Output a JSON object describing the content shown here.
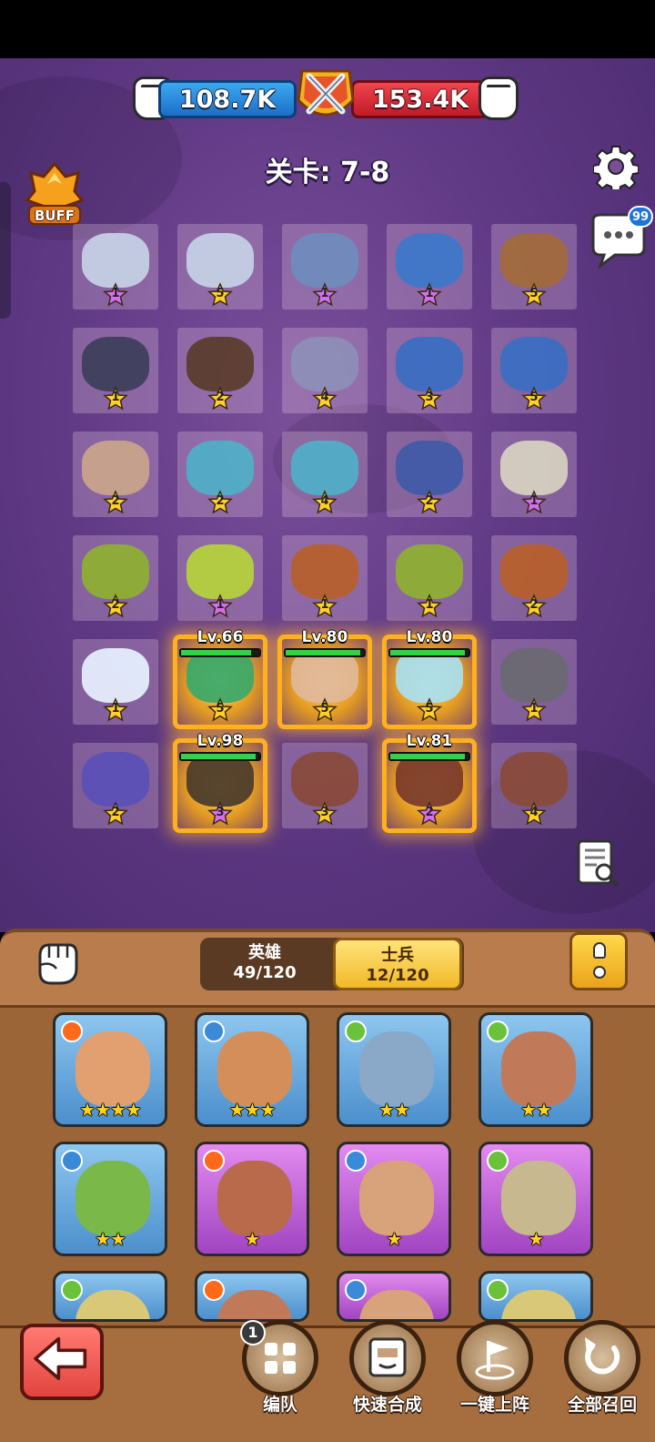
{
  "power": {
    "ally": "108.7K",
    "enemy": "153.4K"
  },
  "level_label": "关卡: 7-8",
  "buff_label": "BUFF",
  "chat_badge": "99",
  "board": [
    [
      {
        "stars": "1",
        "kind": "purple",
        "color": "#c7d3e6"
      },
      {
        "stars": "5",
        "kind": "gold",
        "color": "#c7d3e6"
      },
      {
        "stars": "1",
        "kind": "purple",
        "color": "#6f8dbd"
      },
      {
        "stars": "1",
        "kind": "purple",
        "color": "#3b78c9"
      },
      {
        "stars": "5",
        "kind": "gold",
        "color": "#a36a3a"
      }
    ],
    [
      {
        "stars": "1",
        "kind": "gold",
        "color": "#3c3f5a"
      },
      {
        "stars": "2",
        "kind": "gold",
        "color": "#5a3c2c"
      },
      {
        "stars": "4",
        "kind": "gold",
        "color": "#8d8fb8"
      },
      {
        "stars": "3",
        "kind": "gold",
        "color": "#3b6ec2"
      },
      {
        "stars": "5",
        "kind": "gold",
        "color": "#3b6ec2"
      }
    ],
    [
      {
        "stars": "2",
        "kind": "gold",
        "color": "#caa58a"
      },
      {
        "stars": "2",
        "kind": "gold",
        "color": "#4fb0c8"
      },
      {
        "stars": "4",
        "kind": "gold",
        "color": "#4fb0c8"
      },
      {
        "stars": "2",
        "kind": "gold",
        "color": "#405aa8"
      },
      {
        "stars": "1",
        "kind": "purple",
        "color": "#d8d2c0"
      }
    ],
    [
      {
        "stars": "2",
        "kind": "gold",
        "color": "#8eb030"
      },
      {
        "stars": "1",
        "kind": "purple",
        "color": "#b5d43a"
      },
      {
        "stars": "1",
        "kind": "gold",
        "color": "#b8602a"
      },
      {
        "stars": "1",
        "kind": "gold",
        "color": "#8eb030"
      },
      {
        "stars": "2",
        "kind": "gold",
        "color": "#b8602a"
      }
    ],
    [
      {
        "stars": "1",
        "kind": "gold",
        "color": "#e8f2ff"
      },
      {
        "stars": "5",
        "kind": "gold",
        "color": "#3aa86a",
        "lv": "Lv.66",
        "hp": 0.9,
        "glow": true
      },
      {
        "stars": "5",
        "kind": "gold",
        "color": "#e0b89a",
        "lv": "Lv.80",
        "hp": 0.95,
        "glow": true
      },
      {
        "stars": "5",
        "kind": "gold",
        "color": "#a8e0f0",
        "lv": "Lv.80",
        "hp": 0.95,
        "glow": true
      },
      {
        "stars": "1",
        "kind": "gold",
        "color": "#6a6a72"
      }
    ],
    [
      {
        "stars": "2",
        "kind": "gold",
        "color": "#5a50b8"
      },
      {
        "stars": "3",
        "kind": "purple",
        "color": "#4a3a2a",
        "lv": "Lv.98",
        "hp": 0.95,
        "glow": true
      },
      {
        "stars": "3",
        "kind": "gold",
        "color": "#8a4a3a"
      },
      {
        "stars": "2",
        "kind": "purple",
        "color": "#7a3a2a",
        "lv": "Lv.81",
        "hp": 0.95,
        "glow": true
      },
      {
        "stars": "4",
        "kind": "gold",
        "color": "#8a4a3a"
      }
    ]
  ],
  "tabs": {
    "heroes_label": "英雄",
    "heroes_count": "49/120",
    "soldiers_label": "士兵",
    "soldiers_count": "12/120"
  },
  "cards": [
    {
      "element": "fire",
      "bg": "bg-blue",
      "face": "#e2a070",
      "stars": "★★★★"
    },
    {
      "element": "water",
      "bg": "bg-blue",
      "face": "#d48e5a",
      "stars": "★★★"
    },
    {
      "element": "leaf",
      "bg": "bg-blue",
      "face": "#8aa8c8",
      "stars": "★★"
    },
    {
      "element": "leaf",
      "bg": "bg-blue",
      "face": "#c07a5a",
      "stars": "★★"
    },
    {
      "element": "water",
      "bg": "bg-blue",
      "face": "#7ab84a",
      "stars": "★★"
    },
    {
      "element": "fire",
      "bg": "bg-purple",
      "face": "#b86a4a",
      "stars": "★"
    },
    {
      "element": "water",
      "bg": "bg-purple",
      "face": "#d8a27a",
      "stars": "★"
    },
    {
      "element": "leaf",
      "bg": "bg-purple",
      "face": "#c8b890",
      "stars": "★"
    },
    {
      "element": "leaf",
      "bg": "bg-blue",
      "face": "#d8c878",
      "stars": ""
    },
    {
      "element": "fire",
      "bg": "bg-blue",
      "face": "#c07a5a",
      "stars": ""
    },
    {
      "element": "water",
      "bg": "bg-purple",
      "face": "#d8a27a",
      "stars": ""
    },
    {
      "element": "leaf",
      "bg": "bg-blue",
      "face": "#d8c878",
      "stars": ""
    }
  ],
  "actions": {
    "formation": "编队",
    "formation_badge": "1",
    "quick_merge": "快速合成",
    "one_click_deploy": "一键上阵",
    "recall_all": "全部召回"
  },
  "colors": {
    "fire": "#ff6a1a",
    "water": "#3a8ad8",
    "leaf": "#6ac23a",
    "star_gold": "#ffcf2a",
    "star_purple": "#d56ef0"
  }
}
